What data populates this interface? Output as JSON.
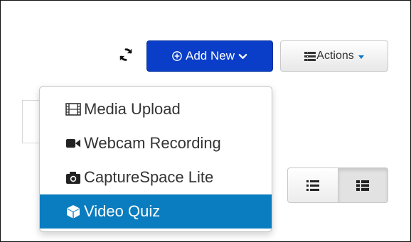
{
  "toolbar": {
    "add_new_label": "Add New",
    "actions_label": "Actions",
    "refresh_icon": "refresh-icon",
    "colors": {
      "primary": "#0a3ec8",
      "menu_active": "#0a7cc0"
    }
  },
  "add_new_menu": {
    "items": [
      {
        "label": "Media Upload",
        "icon": "film-icon",
        "active": false
      },
      {
        "label": "Webcam Recording",
        "icon": "video-camera-icon",
        "active": false
      },
      {
        "label": "CaptureSpace Lite",
        "icon": "camera-icon",
        "active": false
      },
      {
        "label": "Video Quiz",
        "icon": "cube-icon",
        "active": true
      }
    ]
  },
  "view_toggle": {
    "options": [
      {
        "icon": "list-view-icon",
        "active": false
      },
      {
        "icon": "detailed-list-icon",
        "active": true
      }
    ]
  }
}
